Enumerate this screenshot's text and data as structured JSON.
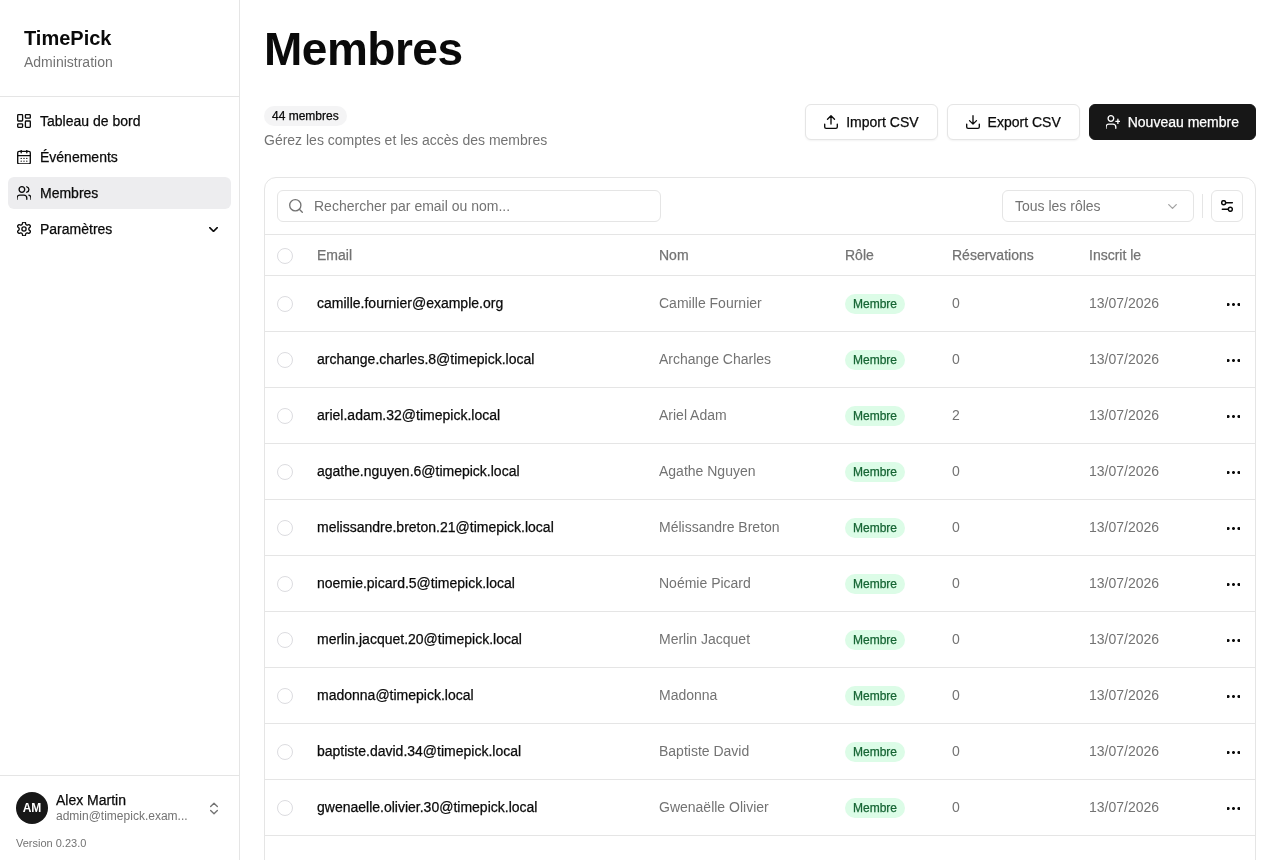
{
  "sidebar": {
    "app_name": "TimePick",
    "app_subtitle": "Administration",
    "nav_items": [
      {
        "kind": "link",
        "label": "Tableau de bord",
        "selected": false
      },
      {
        "kind": "link",
        "label": "Événements",
        "selected": false
      },
      {
        "kind": "link",
        "label": "Membres",
        "selected": true
      },
      {
        "kind": "group",
        "label": "Paramètres",
        "selected": false,
        "expanded": false
      }
    ],
    "user": {
      "initials": "AM",
      "name": "Alex Martin",
      "email": "admin@timepick.exam..."
    },
    "version": "Version 0.23.0"
  },
  "page": {
    "title": "Membres",
    "count_badge": "44 membres",
    "subtitle": "Gérez les comptes et les accès des membres",
    "actions": [
      {
        "kind": "outline",
        "label": "Import CSV"
      },
      {
        "kind": "outline",
        "label": "Export CSV"
      },
      {
        "kind": "primary",
        "label": "Nouveau membre"
      }
    ]
  },
  "toolbar": {
    "search": {
      "placeholder": "Rechercher par email ou nom..."
    },
    "role_filter": {
      "value": "Tous les rôles"
    }
  },
  "table": {
    "select_all_checked": false,
    "columns": [
      "Email",
      "Nom",
      "Rôle",
      "Réservations",
      "Inscrit le"
    ],
    "rows": [
      {
        "checked": false,
        "email": "camille.fournier@example.org",
        "name": "Camille Fournier",
        "role": "Membre",
        "reservations": "0",
        "joined": "13/07/2026"
      },
      {
        "checked": false,
        "email": "archange.charles.8@timepick.local",
        "name": "Archange Charles",
        "role": "Membre",
        "reservations": "0",
        "joined": "13/07/2026"
      },
      {
        "checked": false,
        "email": "ariel.adam.32@timepick.local",
        "name": "Ariel Adam",
        "role": "Membre",
        "reservations": "2",
        "joined": "13/07/2026"
      },
      {
        "checked": false,
        "email": "agathe.nguyen.6@timepick.local",
        "name": "Agathe Nguyen",
        "role": "Membre",
        "reservations": "0",
        "joined": "13/07/2026"
      },
      {
        "checked": false,
        "email": "melissandre.breton.21@timepick.local",
        "name": "Mélissandre Breton",
        "role": "Membre",
        "reservations": "0",
        "joined": "13/07/2026"
      },
      {
        "checked": false,
        "email": "noemie.picard.5@timepick.local",
        "name": "Noémie Picard",
        "role": "Membre",
        "reservations": "0",
        "joined": "13/07/2026"
      },
      {
        "checked": false,
        "email": "merlin.jacquet.20@timepick.local",
        "name": "Merlin Jacquet",
        "role": "Membre",
        "reservations": "0",
        "joined": "13/07/2026"
      },
      {
        "checked": false,
        "email": "madonna@timepick.local",
        "name": "Madonna",
        "role": "Membre",
        "reservations": "0",
        "joined": "13/07/2026"
      },
      {
        "checked": false,
        "email": "baptiste.david.34@timepick.local",
        "name": "Baptiste David",
        "role": "Membre",
        "reservations": "0",
        "joined": "13/07/2026"
      },
      {
        "checked": false,
        "email": "gwenaelle.olivier.30@timepick.local",
        "name": "Gwenaëlle Olivier",
        "role": "Membre",
        "reservations": "0",
        "joined": "13/07/2026"
      }
    ]
  }
}
